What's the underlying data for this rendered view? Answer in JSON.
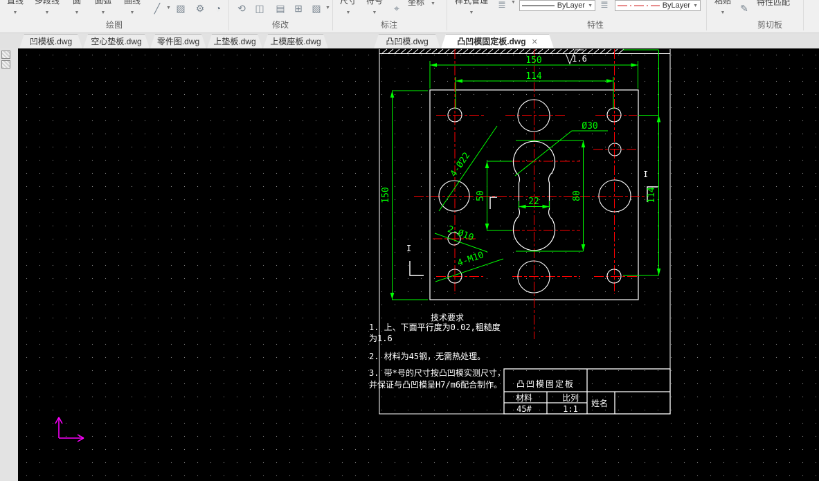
{
  "ribbon": {
    "draw": {
      "label": "绘图",
      "line": "直线",
      "polyline": "多段线",
      "circle": "圆",
      "arc": "圆弧",
      "curve": "曲线"
    },
    "modify": {
      "label": "修改"
    },
    "annotate": {
      "label": "标注",
      "dim": "尺寸",
      "symbol": "符号",
      "coord": "坐标"
    },
    "properties": {
      "label": "特性",
      "style_manager": "样式管理",
      "color_value": "ByLayer",
      "linetype_value": "ByLayer"
    },
    "clipboard": {
      "label": "剪切板",
      "paste": "粘贴",
      "match": "特性匹配"
    }
  },
  "icons": [
    "line-icon",
    "hatch-icon",
    "gear-icon",
    "pie-icon",
    "rotate-icon",
    "mirror-icon",
    "array-icon",
    "offset-icon",
    "trim-icon",
    "coord-icon",
    "lineweight-icon",
    "paste-icon",
    "match-brush-icon",
    "close-icon",
    "raster-icon",
    "table-icon",
    "pin-icon"
  ],
  "tabs": {
    "items": [
      {
        "label": "凹模板.dwg"
      },
      {
        "label": "空心垫板.dwg"
      },
      {
        "label": "零件图.dwg"
      },
      {
        "label": "上垫板.dwg"
      },
      {
        "label": "上模座板.dwg"
      },
      {
        "label": "凸凹模.dwg"
      },
      {
        "label": "凸凹模固定板.dwg"
      }
    ],
    "active_index": 6,
    "close_glyph": "✕"
  },
  "drawing": {
    "dims": {
      "top_width": "150",
      "hole_span_h": "114",
      "left_height": "150",
      "right_span_v": "114",
      "center_distance": "50",
      "slot_height": "80",
      "waist": "22",
      "bore": "Ø30",
      "holes22": "4-Ø22",
      "holes10": "2-Ø10",
      "threads": "4-M10",
      "roughness": "1.6",
      "section_mark": "I"
    },
    "tech": {
      "title": "技术要求",
      "lines": [
        "1. 上、下面平行度为0.02,粗糙度",
        "为1.6",
        "2. 材料为45钢，无需热处理。",
        "3. 带*号的尺寸按凸凹模实测尺寸，",
        "并保证与凸凹模呈H7/m6配合制作。"
      ]
    },
    "title_block": {
      "part_name": "凸凹模固定板",
      "material_label": "材料",
      "material_value": "45#",
      "scale_label": "比列",
      "scale_value": "1:1",
      "name_label": "姓名"
    },
    "colors": {
      "dimension_green": "#00ff00",
      "centerline_red": "#ff0000",
      "outline_white": "#ffffff",
      "ucs_magenta": "#ff00ff"
    }
  }
}
